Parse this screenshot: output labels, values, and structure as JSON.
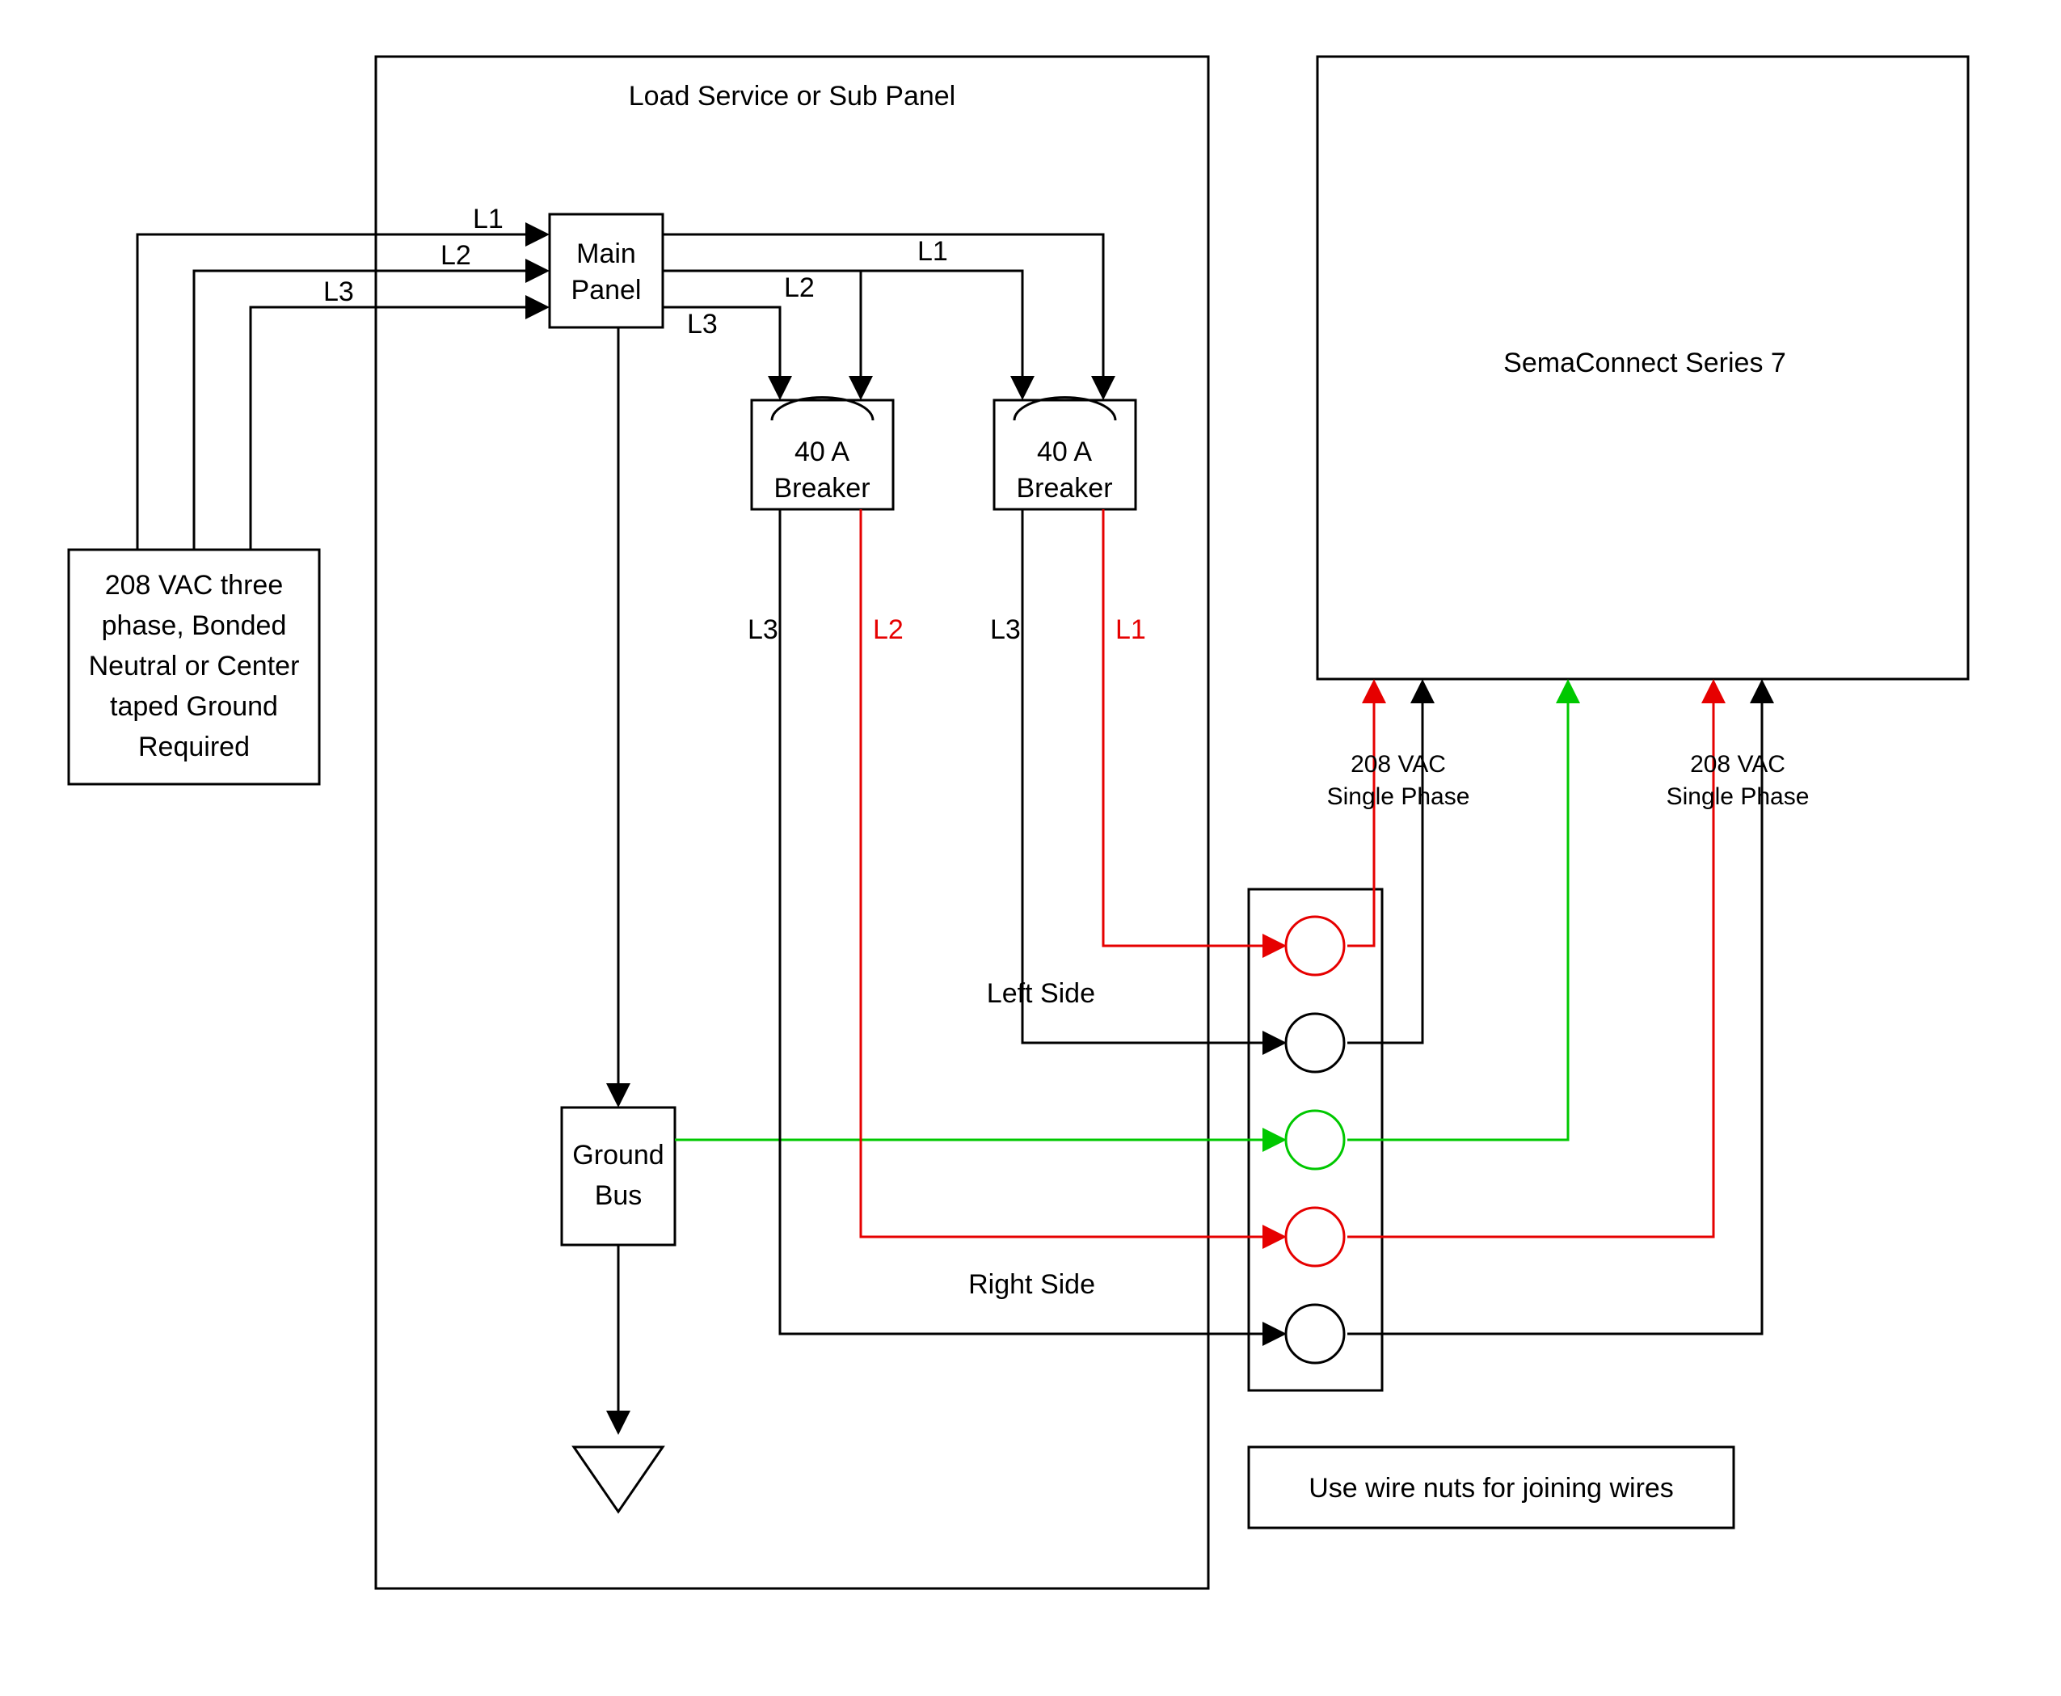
{
  "title_panel": "Load Service or Sub Panel",
  "source_box": {
    "l1": "208 VAC three",
    "l2": "phase, Bonded",
    "l3": "Neutral or Center",
    "l4": "taped Ground",
    "l5": "Required"
  },
  "lines": {
    "L1": "L1",
    "L2": "L2",
    "L3": "L3"
  },
  "main_panel": {
    "l1": "Main",
    "l2": "Panel"
  },
  "breaker_left": {
    "l1": "40 A",
    "l2": "Breaker"
  },
  "breaker_right": {
    "l1": "40 A",
    "l2": "Breaker"
  },
  "breaker_left_out": {
    "L3": "L3",
    "L2": "L2"
  },
  "breaker_right_out": {
    "L3": "L3",
    "L1": "L1"
  },
  "ground_bus": {
    "l1": "Ground",
    "l2": "Bus"
  },
  "sides": {
    "left": "Left Side",
    "right": "Right Side"
  },
  "device": "SemaConnect Series 7",
  "phase1": {
    "l1": "208 VAC",
    "l2": "Single Phase"
  },
  "phase2": {
    "l1": "208 VAC",
    "l2": "Single Phase"
  },
  "notes": "Use wire nuts for joining wires",
  "colors": {
    "black": "#000000",
    "red": "#e60000",
    "green": "#00c800"
  }
}
